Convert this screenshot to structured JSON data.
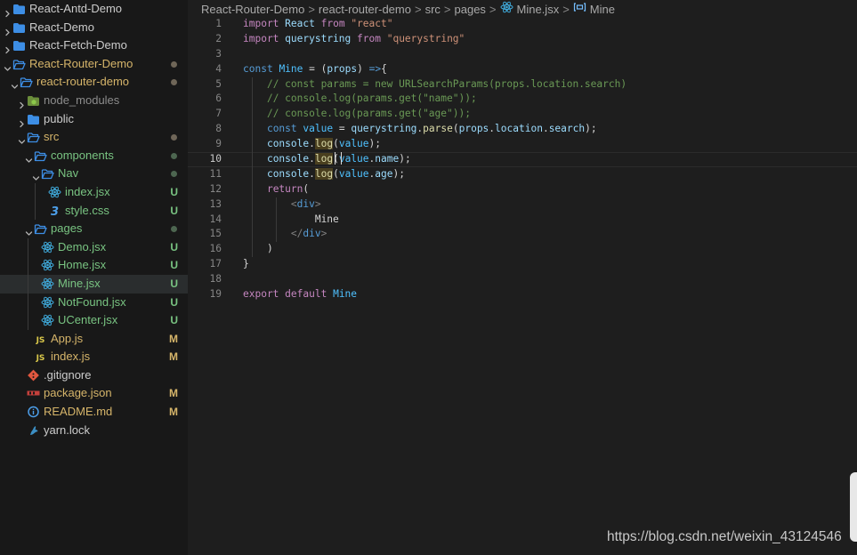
{
  "colors": {
    "folder": "#3d8ee5",
    "react": "#3fa8d8",
    "js": "#d9c74a",
    "css": "#4c9ee8",
    "git": "#e2573f",
    "npm": "#c4403b",
    "readme": "#4c9ee8",
    "yarn": "#3c8fc4",
    "modified": "#c9ad62",
    "untracked": "#66a86c",
    "label_default": "#cccccc",
    "label_untracked": "#79c482",
    "label_modified": "#d6b56a"
  },
  "explorer": {
    "items": [
      {
        "label": "React-Antd-Demo",
        "depth": 0,
        "kind": "folder",
        "expanded": false,
        "icon": "folder-icon",
        "status": ""
      },
      {
        "label": "React-Demo",
        "depth": 0,
        "kind": "folder",
        "expanded": false,
        "icon": "folder-icon",
        "status": ""
      },
      {
        "label": "React-Fetch-Demo",
        "depth": 0,
        "kind": "folder",
        "expanded": false,
        "icon": "folder-icon",
        "status": ""
      },
      {
        "label": "React-Router-Demo",
        "depth": 0,
        "kind": "folder",
        "expanded": true,
        "icon": "folder-open-icon",
        "status": "dot-modified"
      },
      {
        "label": "react-router-demo",
        "depth": 1,
        "kind": "folder",
        "expanded": true,
        "icon": "folder-open-icon",
        "status": "dot-modified"
      },
      {
        "label": "node_modules",
        "depth": 2,
        "kind": "folder",
        "expanded": false,
        "icon": "node-modules-folder-icon",
        "status": "",
        "dim": true
      },
      {
        "label": "public",
        "depth": 2,
        "kind": "folder",
        "expanded": false,
        "icon": "folder-icon",
        "status": ""
      },
      {
        "label": "src",
        "depth": 2,
        "kind": "folder",
        "expanded": true,
        "icon": "folder-open-icon",
        "status": "dot-modified"
      },
      {
        "label": "components",
        "depth": 3,
        "kind": "folder",
        "expanded": true,
        "icon": "folder-open-icon",
        "status": "dot-untracked"
      },
      {
        "label": "Nav",
        "depth": 4,
        "kind": "folder",
        "expanded": true,
        "icon": "folder-open-icon",
        "status": "dot-untracked"
      },
      {
        "label": "index.jsx",
        "depth": 5,
        "kind": "file",
        "icon": "react-icon",
        "status": "U"
      },
      {
        "label": "style.css",
        "depth": 5,
        "kind": "file",
        "icon": "css-icon",
        "status": "U"
      },
      {
        "label": "pages",
        "depth": 3,
        "kind": "folder",
        "expanded": true,
        "icon": "folder-open-icon",
        "status": "dot-untracked"
      },
      {
        "label": "Demo.jsx",
        "depth": 4,
        "kind": "file",
        "icon": "react-icon",
        "status": "U"
      },
      {
        "label": "Home.jsx",
        "depth": 4,
        "kind": "file",
        "icon": "react-icon",
        "status": "U"
      },
      {
        "label": "Mine.jsx",
        "depth": 4,
        "kind": "file",
        "icon": "react-icon",
        "status": "U",
        "selected": true
      },
      {
        "label": "NotFound.jsx",
        "depth": 4,
        "kind": "file",
        "icon": "react-icon",
        "status": "U"
      },
      {
        "label": "UCenter.jsx",
        "depth": 4,
        "kind": "file",
        "icon": "react-icon",
        "status": "U"
      },
      {
        "label": "App.js",
        "depth": 3,
        "kind": "file",
        "icon": "js-icon",
        "status": "M"
      },
      {
        "label": "index.js",
        "depth": 3,
        "kind": "file",
        "icon": "js-icon",
        "status": "M"
      },
      {
        "label": ".gitignore",
        "depth": 2,
        "kind": "file",
        "icon": "git-icon",
        "status": ""
      },
      {
        "label": "package.json",
        "depth": 2,
        "kind": "file",
        "icon": "npm-icon",
        "status": "M"
      },
      {
        "label": "README.md",
        "depth": 2,
        "kind": "file",
        "icon": "readme-icon",
        "status": "M"
      },
      {
        "label": "yarn.lock",
        "depth": 2,
        "kind": "file",
        "icon": "yarn-icon",
        "status": ""
      }
    ]
  },
  "breadcrumb": {
    "segments": [
      "React-Router-Demo",
      "react-router-demo",
      "src",
      "pages",
      "Mine.jsx",
      "Mine"
    ],
    "separator": ">"
  },
  "editor": {
    "current_line": 10,
    "lines": [
      [
        [
          "import",
          "kw"
        ],
        [
          " ",
          "pl"
        ],
        [
          "React",
          "var"
        ],
        [
          " ",
          "pl"
        ],
        [
          "from",
          "kw"
        ],
        [
          " ",
          "pl"
        ],
        [
          "\"react\"",
          "str"
        ]
      ],
      [
        [
          "import",
          "kw"
        ],
        [
          " ",
          "pl"
        ],
        [
          "querystring",
          "var"
        ],
        [
          " ",
          "pl"
        ],
        [
          "from",
          "kw"
        ],
        [
          " ",
          "pl"
        ],
        [
          "\"querystring\"",
          "str"
        ]
      ],
      [],
      [
        [
          "const",
          "st"
        ],
        [
          " ",
          "pl"
        ],
        [
          "Mine",
          "cn"
        ],
        [
          " ",
          "pl"
        ],
        [
          "=",
          "op"
        ],
        [
          " ",
          "pl"
        ],
        [
          "(",
          "pl"
        ],
        [
          "props",
          "var"
        ],
        [
          ")",
          "pl"
        ],
        [
          " ",
          "pl"
        ],
        [
          "=>",
          "st"
        ],
        [
          "{",
          "pl"
        ]
      ],
      [
        [
          "    ",
          "pl"
        ],
        [
          "// const params = new URLSearchParams(props.location.search)",
          "cm"
        ]
      ],
      [
        [
          "    ",
          "pl"
        ],
        [
          "// console.log(params.get(\"name\"));",
          "cm"
        ]
      ],
      [
        [
          "    ",
          "pl"
        ],
        [
          "// console.log(params.get(\"age\"));",
          "cm"
        ]
      ],
      [
        [
          "    ",
          "pl"
        ],
        [
          "const",
          "st"
        ],
        [
          " ",
          "pl"
        ],
        [
          "value",
          "cn"
        ],
        [
          " ",
          "pl"
        ],
        [
          "=",
          "op"
        ],
        [
          " ",
          "pl"
        ],
        [
          "querystring",
          "var"
        ],
        [
          ".",
          "pl"
        ],
        [
          "parse",
          "fn"
        ],
        [
          "(",
          "pl"
        ],
        [
          "props",
          "var"
        ],
        [
          ".",
          "pl"
        ],
        [
          "location",
          "var"
        ],
        [
          ".",
          "pl"
        ],
        [
          "search",
          "var"
        ],
        [
          ");",
          "pl"
        ]
      ],
      [
        [
          "    ",
          "pl"
        ],
        [
          "console",
          "var"
        ],
        [
          ".",
          "pl"
        ],
        [
          "log",
          "fnh"
        ],
        [
          "(",
          "pl"
        ],
        [
          "value",
          "cn"
        ],
        [
          ");",
          "pl"
        ]
      ],
      [
        [
          "    ",
          "pl"
        ],
        [
          "console",
          "var"
        ],
        [
          ".",
          "pl"
        ],
        [
          "log",
          "fnh"
        ],
        [
          "(",
          "pl"
        ],
        [
          "value",
          "cn"
        ],
        [
          ".",
          "pl"
        ],
        [
          "name",
          "var"
        ],
        [
          ")",
          "pl"
        ],
        [
          ";",
          "pl"
        ]
      ],
      [
        [
          "    ",
          "pl"
        ],
        [
          "console",
          "var"
        ],
        [
          ".",
          "pl"
        ],
        [
          "log",
          "fnh"
        ],
        [
          "(",
          "pl"
        ],
        [
          "value",
          "cn"
        ],
        [
          ".",
          "pl"
        ],
        [
          "age",
          "var"
        ],
        [
          ");",
          "pl"
        ]
      ],
      [
        [
          "    ",
          "pl"
        ],
        [
          "return",
          "kw"
        ],
        [
          "(",
          "pl"
        ]
      ],
      [
        [
          "        ",
          "pl"
        ],
        [
          "<",
          "tgb"
        ],
        [
          "div",
          "tg"
        ],
        [
          ">",
          "tgb"
        ]
      ],
      [
        [
          "            ",
          "pl"
        ],
        [
          "Mine",
          "pl"
        ]
      ],
      [
        [
          "        ",
          "pl"
        ],
        [
          "</",
          "tgb"
        ],
        [
          "div",
          "tg"
        ],
        [
          ">",
          "tgb"
        ]
      ],
      [
        [
          "    ",
          "pl"
        ],
        [
          ")",
          "pl"
        ]
      ],
      [
        [
          "}",
          "pl"
        ]
      ],
      [],
      [
        [
          "export",
          "kw"
        ],
        [
          " ",
          "pl"
        ],
        [
          "default",
          "kw"
        ],
        [
          " ",
          "pl"
        ],
        [
          "Mine",
          "cn"
        ]
      ]
    ]
  },
  "syntax_colors": {
    "kw": "#c586c0",
    "st": "#569cd6",
    "var": "#9cdcfe",
    "cn": "#4fc1ff",
    "fn": "#dcdcaa",
    "fnh": "#dcdcaa",
    "str": "#ce9178",
    "cm": "#6a9955",
    "op": "#d4d4d4",
    "pl": "#d4d4d4",
    "tg": "#569cd6",
    "tgb": "#808080"
  },
  "watermark": "https://blog.csdn.net/weixin_43124546"
}
